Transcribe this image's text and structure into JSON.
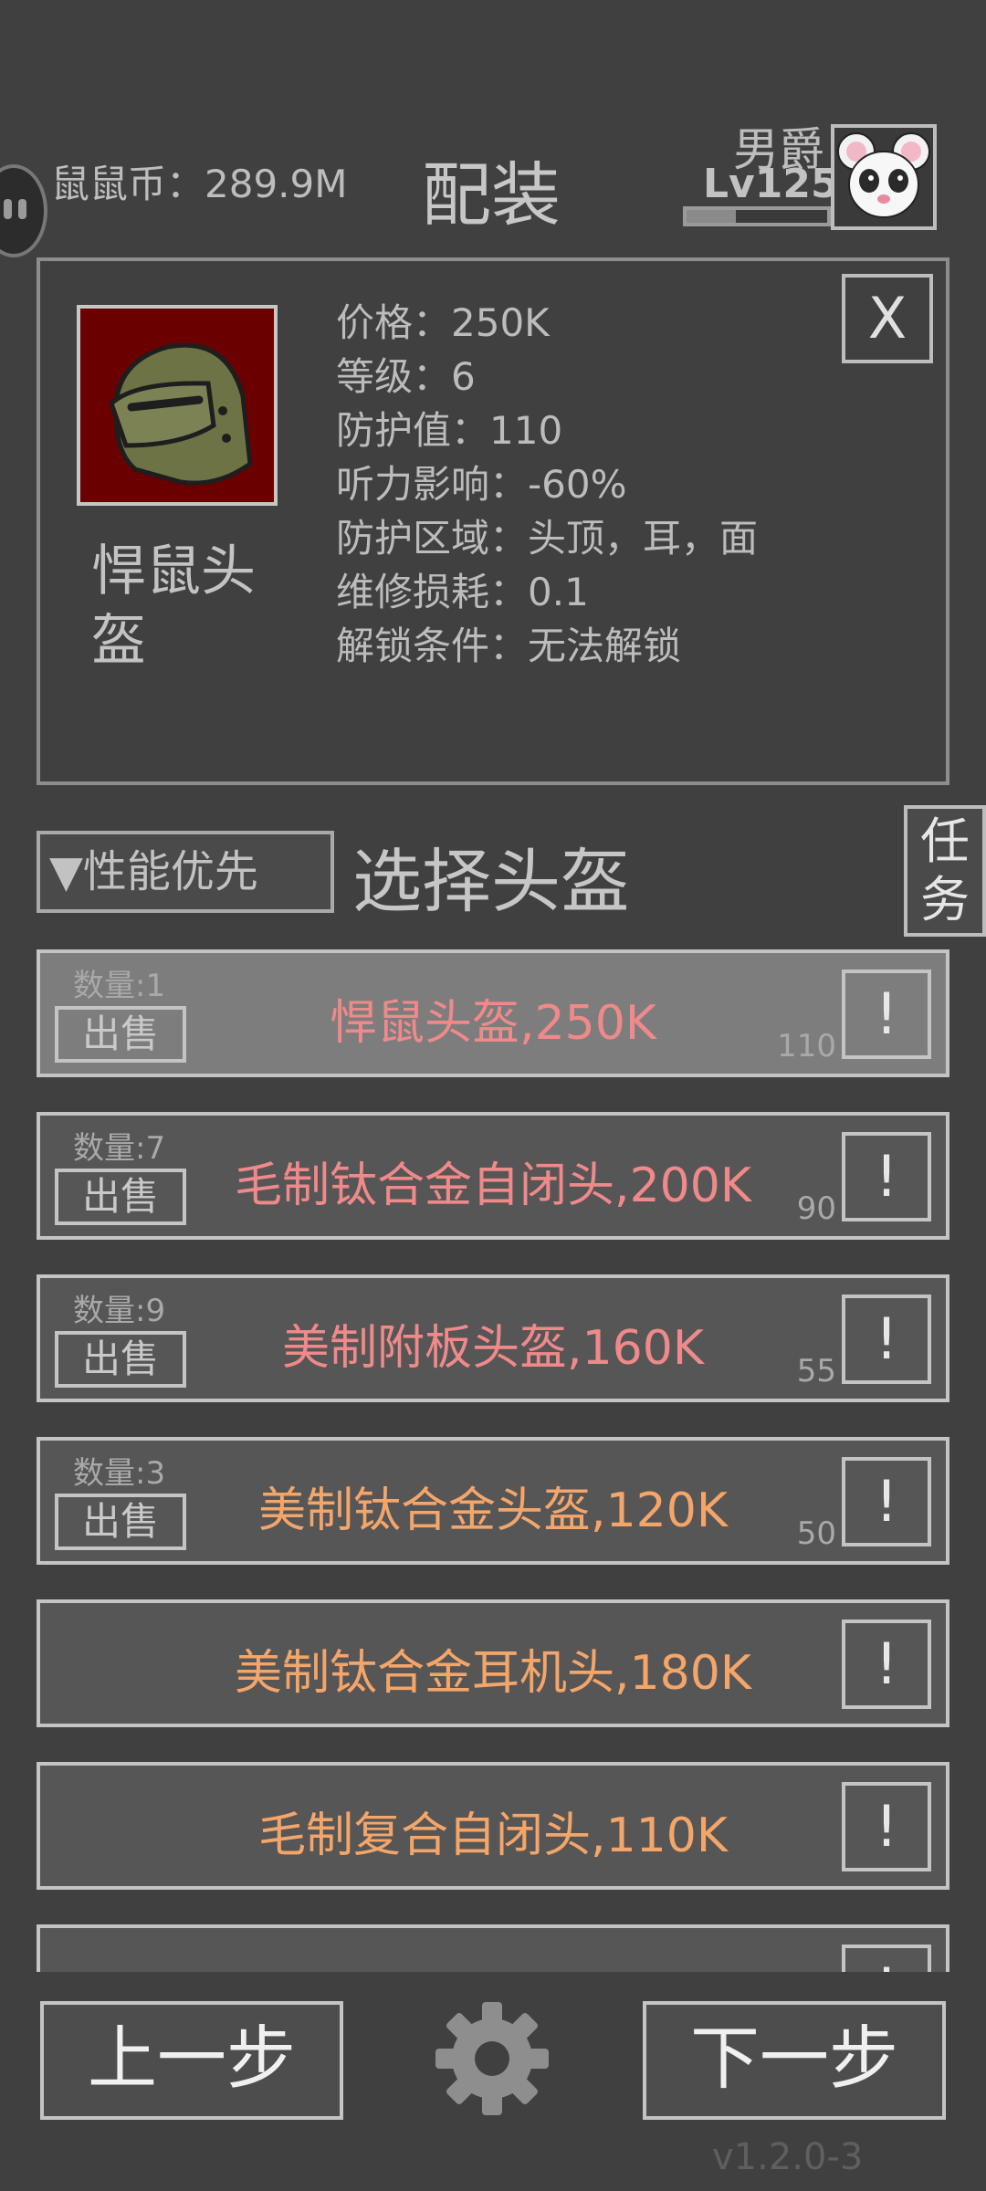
{
  "header": {
    "coin_label": "鼠鼠币：289.9M",
    "title": "配装",
    "rank_name": "男爵",
    "level": "Lv125",
    "xp_progress": 0.35
  },
  "detail": {
    "item_name": "悍鼠头盔",
    "close_label": "X",
    "stats": [
      "价格：250K",
      "等级：6",
      "防护值：110",
      "听力影响：-60%",
      "防护区域：头顶，耳，面",
      "维修损耗：0.1",
      "解锁条件：无法解锁"
    ]
  },
  "controls": {
    "sort_label": "▼性能优先",
    "select_title": "选择头盔",
    "task_label": "任务"
  },
  "items": [
    {
      "qty": "数量:1",
      "sell": "出售",
      "name": "悍鼠头盔,250K",
      "defense": "110",
      "info": "!",
      "color": "#f08a8a",
      "selected": true
    },
    {
      "qty": "数量:7",
      "sell": "出售",
      "name": "毛制钛合金自闭头,200K",
      "defense": "90",
      "info": "!",
      "color": "#f08a8a"
    },
    {
      "qty": "数量:9",
      "sell": "出售",
      "name": "美制附板头盔,160K",
      "defense": "55",
      "info": "!",
      "color": "#f08a8a"
    },
    {
      "qty": "数量:3",
      "sell": "出售",
      "name": "美制钛合金头盔,120K",
      "defense": "50",
      "info": "!",
      "color": "#f4a66a"
    },
    {
      "qty": "",
      "sell": "",
      "name": "美制钛合金耳机头,180K",
      "defense": "",
      "info": "!",
      "color": "#f4a66a"
    },
    {
      "qty": "",
      "sell": "",
      "name": "毛制复合自闭头,110K",
      "defense": "",
      "info": "!",
      "color": "#f4a66a"
    },
    {
      "qty": "",
      "sell": "",
      "name": "",
      "defense": "",
      "info": "!",
      "color": "#f4a66a"
    }
  ],
  "footer": {
    "prev_label": "上一步",
    "next_label": "下一步",
    "version": "v1.2.0-3"
  }
}
